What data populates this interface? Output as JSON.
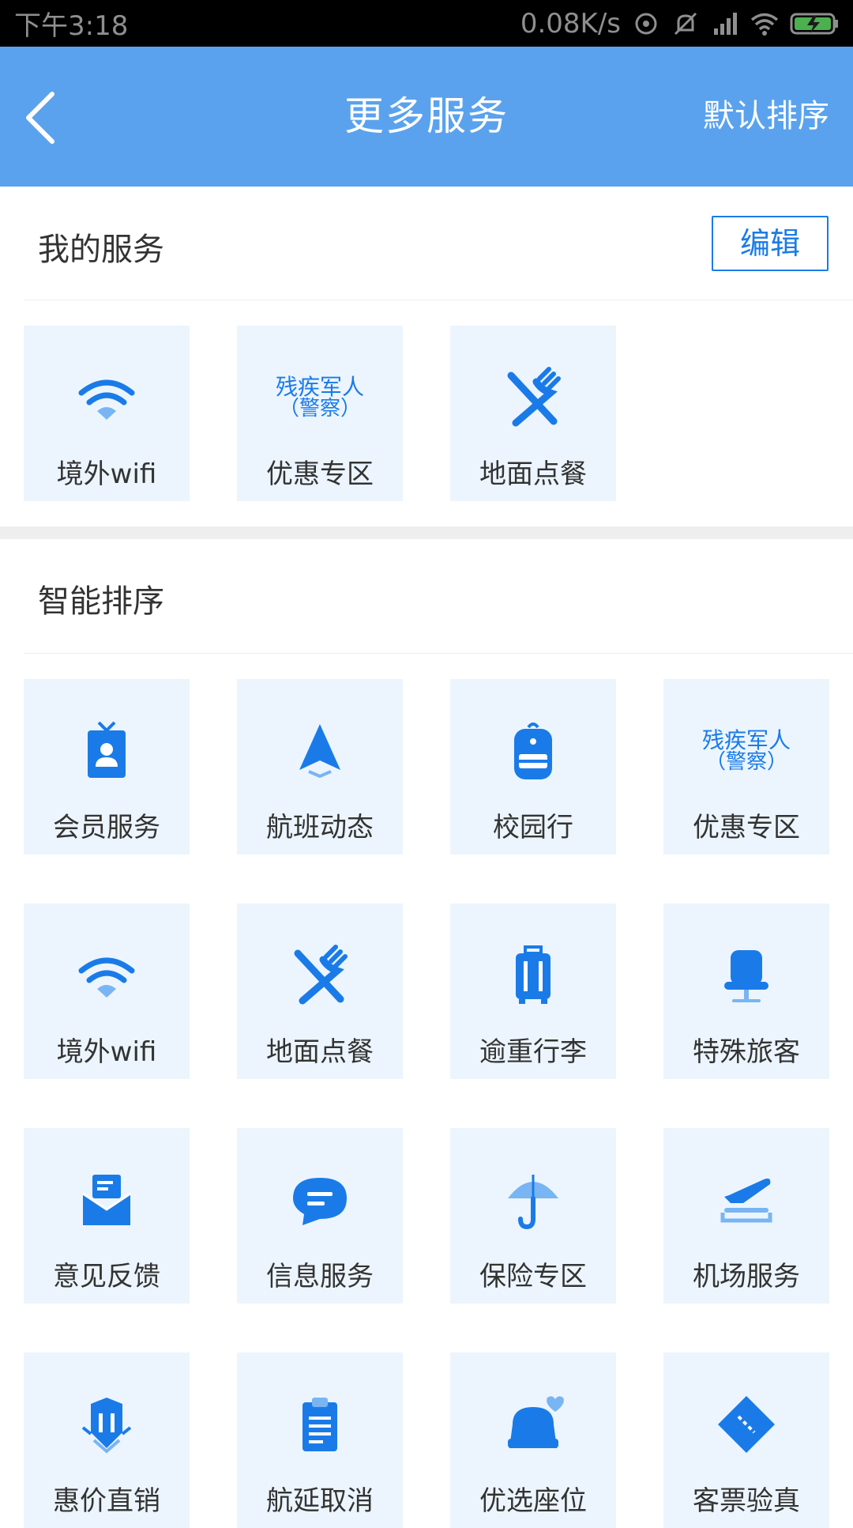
{
  "status_bar": {
    "time": "下午3:18",
    "speed": "0.08K/s"
  },
  "header": {
    "title": "更多服务",
    "sort_label": "默认排序"
  },
  "my_services": {
    "title": "我的服务",
    "edit_label": "编辑",
    "items": [
      {
        "label": "境外wifi",
        "icon": "wifi-icon"
      },
      {
        "label": "优惠专区",
        "icon": "discount-text-icon",
        "icon_text_1": "残疾军人",
        "icon_text_2": "（警察）"
      },
      {
        "label": "地面点餐",
        "icon": "utensils-icon"
      }
    ]
  },
  "smart_sort": {
    "title": "智能排序",
    "items": [
      {
        "label": "会员服务",
        "icon": "member-card-icon"
      },
      {
        "label": "航班动态",
        "icon": "navigation-arrow-icon"
      },
      {
        "label": "校园行",
        "icon": "backpack-icon"
      },
      {
        "label": "优惠专区",
        "icon": "discount-text-icon",
        "icon_text_1": "残疾军人",
        "icon_text_2": "（警察）"
      },
      {
        "label": "境外wifi",
        "icon": "wifi-icon"
      },
      {
        "label": "地面点餐",
        "icon": "utensils-icon"
      },
      {
        "label": "逾重行李",
        "icon": "luggage-icon"
      },
      {
        "label": "特殊旅客",
        "icon": "seat-icon"
      },
      {
        "label": "意见反馈",
        "icon": "mail-icon"
      },
      {
        "label": "信息服务",
        "icon": "chat-bubble-icon"
      },
      {
        "label": "保险专区",
        "icon": "umbrella-icon"
      },
      {
        "label": "机场服务",
        "icon": "airport-icon"
      },
      {
        "label": "惠价直销",
        "icon": "badge-icon"
      },
      {
        "label": "航延取消",
        "icon": "clipboard-icon"
      },
      {
        "label": "优选座位",
        "icon": "heart-seat-icon"
      },
      {
        "label": "客票验真",
        "icon": "ticket-icon"
      }
    ]
  },
  "colors": {
    "header_bg": "#5aa2ee",
    "accent": "#1a7be8",
    "tile_bg": "#ecf5fd"
  }
}
